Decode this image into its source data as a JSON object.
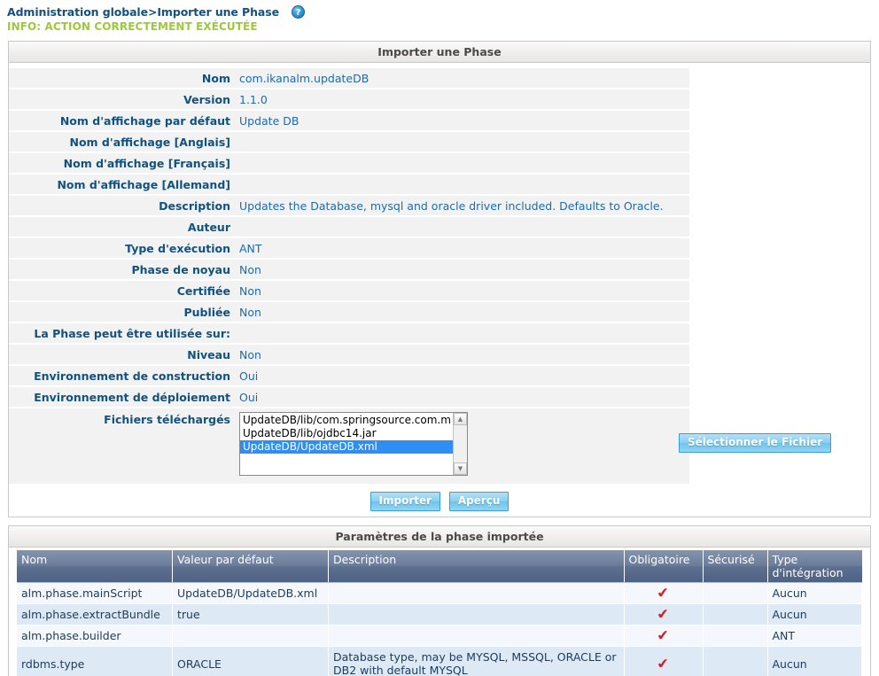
{
  "breadcrumb": {
    "text": "Administration globale>Importer une Phase",
    "help_icon": "help-question-icon",
    "help_glyph": "?"
  },
  "info_message": "INFO: ACTION CORRECTEMENT EXÉCUTÉE",
  "import_panel": {
    "title": "Importer une Phase",
    "fields": [
      {
        "label": "Nom",
        "value": "com.ikanalm.updateDB"
      },
      {
        "label": "Version",
        "value": "1.1.0"
      },
      {
        "label": "Nom d'affichage par défaut",
        "value": "Update DB"
      },
      {
        "label": "Nom d'affichage [Anglais]",
        "value": ""
      },
      {
        "label": "Nom d'affichage [Français]",
        "value": ""
      },
      {
        "label": "Nom d'affichage [Allemand]",
        "value": ""
      },
      {
        "label": "Description",
        "value": "Updates the Database, mysql and oracle driver included. Defaults to Oracle."
      },
      {
        "label": "Auteur",
        "value": ""
      },
      {
        "label": "Type d'exécution",
        "value": "ANT"
      },
      {
        "label": "Phase de noyau",
        "value": "Non"
      },
      {
        "label": "Certifiée",
        "value": "Non"
      },
      {
        "label": "Publiée",
        "value": "Non"
      },
      {
        "label": "La Phase peut être utilisée sur:",
        "value": ""
      },
      {
        "label": "Niveau",
        "value": "Non"
      },
      {
        "label": "Environnement de construction",
        "value": "Oui"
      },
      {
        "label": "Environnement de déploiement",
        "value": "Oui"
      }
    ],
    "files_label": "Fichiers téléchargés",
    "files": [
      {
        "name": "UpdateDB/lib/com.springsource.com.m",
        "selected": false
      },
      {
        "name": "UpdateDB/lib/ojdbc14.jar",
        "selected": false
      },
      {
        "name": "UpdateDB/UpdateDB.xml",
        "selected": true
      }
    ],
    "select_file_button": "Sélectionner le Fichier",
    "import_button": "Importer",
    "preview_button": "Aperçu",
    "scroll_up_glyph": "▲",
    "scroll_down_glyph": "▼"
  },
  "params_panel": {
    "title": "Paramètres de la phase importée",
    "columns": [
      "Nom",
      "Valeur par défaut",
      "Description",
      "Obligatoire",
      "Sécurisé",
      "Type d'intégration"
    ],
    "check_glyph": "✔",
    "rows": [
      {
        "nom": "alm.phase.mainScript",
        "valeur": "UpdateDB/UpdateDB.xml",
        "description": "",
        "obligatoire": true,
        "securise": false,
        "type": "Aucun"
      },
      {
        "nom": "alm.phase.extractBundle",
        "valeur": "true",
        "description": "",
        "obligatoire": true,
        "securise": false,
        "type": "Aucun"
      },
      {
        "nom": "alm.phase.builder",
        "valeur": "",
        "description": "",
        "obligatoire": true,
        "securise": false,
        "type": "ANT"
      },
      {
        "nom": "rdbms.type",
        "valeur": "ORACLE",
        "description": "Database type, may be MYSQL, MSSQL, ORACLE or DB2 with default MYSQL",
        "obligatoire": true,
        "securise": false,
        "type": "Aucun"
      }
    ]
  },
  "colors": {
    "label_blue": "#13517f",
    "value_blue": "#1c6bb0",
    "info_green": "#9dc939",
    "selection_blue": "#2f8ef4",
    "check_red": "#d0202a",
    "table_header": "#5d7090"
  }
}
